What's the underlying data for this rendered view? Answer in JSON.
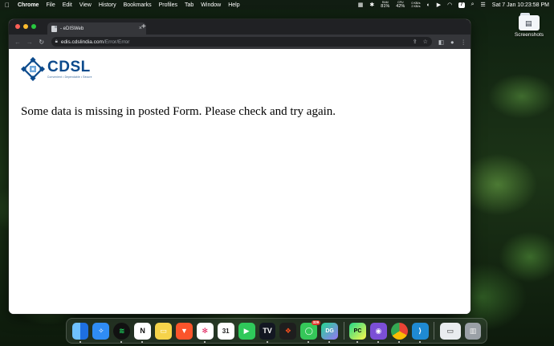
{
  "menubar": {
    "apple_icon": "apple-icon",
    "app_name": "Chrome",
    "menus": [
      "File",
      "Edit",
      "View",
      "History",
      "Bookmarks",
      "Profiles",
      "Tab",
      "Window",
      "Help"
    ],
    "ram_label": "RAM",
    "ram_value": "81%",
    "cpu_label": "CPU",
    "cpu_value": "42%",
    "net_up": "0 KB/s",
    "net_down": "2 KB/s",
    "battery_badge": "7",
    "clock": "Sat 7 Jan  10:23:58 PM"
  },
  "desktop": {
    "icon_label": "Screenshots"
  },
  "browser": {
    "tab_title": "- eDISWeb",
    "tab_close": "×",
    "new_tab": "+",
    "url_host": "edis.cdslindia.com",
    "url_path": "/Error/Error"
  },
  "page": {
    "logo_text": "CDSL",
    "logo_tagline": "Convenient  •  Dependable  •  Secure",
    "message": "Some data is missing in posted Form. Please check and try again."
  },
  "dock": {
    "apps": [
      {
        "name": "Finder",
        "color": "#1e7cf0"
      },
      {
        "name": "Safari",
        "color": "#2f8cf5"
      },
      {
        "name": "Spotify",
        "color": "#1ed760"
      },
      {
        "name": "Notion",
        "color": "#ffffff"
      },
      {
        "name": "Notes",
        "color": "#f5d34a"
      },
      {
        "name": "Brave",
        "color": "#fb542b"
      },
      {
        "name": "Slack",
        "color": "#ffffff"
      },
      {
        "name": "Calendar",
        "color": "#ffffff"
      },
      {
        "name": "FaceTime",
        "color": "#2fc95a"
      },
      {
        "name": "TradingView",
        "color": "#131722"
      },
      {
        "name": "Figma",
        "color": "#1e1e1e"
      },
      {
        "name": "Messages",
        "color": "#35c759"
      },
      {
        "name": "DataGrip",
        "color": "#22d88f"
      },
      {
        "name": "PyCharm",
        "color": "#21d789"
      },
      {
        "name": "GitHub Desktop",
        "color": "#7b4fd6"
      },
      {
        "name": "Chrome",
        "color": "#ffffff"
      },
      {
        "name": "VS Code",
        "color": "#1f8ad2"
      },
      {
        "name": "Preview",
        "color": "#e9ecef"
      },
      {
        "name": "Trash",
        "color": "#9aa0a6"
      }
    ],
    "calendar_day": "31",
    "messages_badge": "329",
    "datagrip_label": "DG",
    "pycharm_label": "PC"
  }
}
